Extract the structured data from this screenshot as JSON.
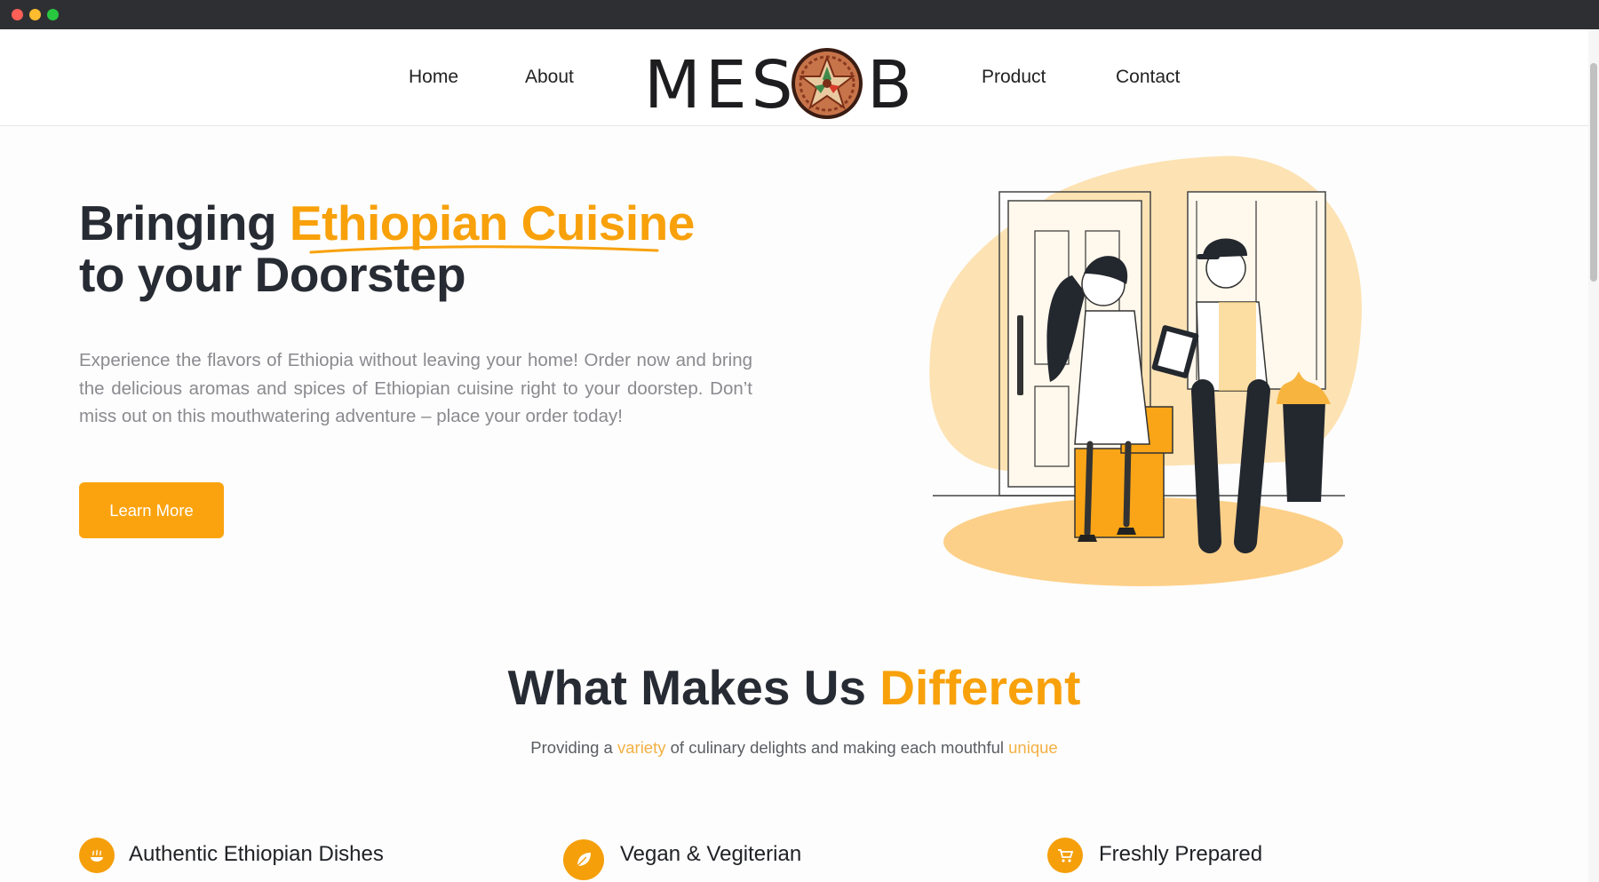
{
  "nav": {
    "left_links": [
      "Home",
      "About"
    ],
    "right_links": [
      "Product",
      "Contact"
    ],
    "logo": {
      "text_before": "MES",
      "text_after": "B",
      "icon": "mesob-basket-icon"
    }
  },
  "hero": {
    "title_part1": "Bringing ",
    "title_accent": "Ethiopian Cuisine",
    "title_line2": "to your Doorstep",
    "description": "Experience the flavors of Ethiopia without leaving your home! Order now and bring the delicious aromas and spices of Ethiopian cuisine right to your doorstep. Don’t miss out on this mouthwatering adventure – place your order today!",
    "button_label": "Learn More",
    "illustration": "delivery-illustration"
  },
  "section": {
    "title_plain": "What Makes Us ",
    "title_accent": "Different",
    "sub_1": "Providing a ",
    "sub_hl_1": "variety",
    "sub_2": " of culinary delights and making each mouthful ",
    "sub_hl_2": "unique"
  },
  "features": [
    {
      "label": "Authentic Ethiopian Dishes",
      "icon": "dish-icon"
    },
    {
      "label": "Vegan & Vegiterian",
      "icon": "leaf-icon"
    },
    {
      "label": "Freshly Prepared",
      "icon": "cart-icon"
    }
  ],
  "colors": {
    "accent": "#f8a10b",
    "button": "#fba30e",
    "text": "#272b33",
    "muted": "#8a8a8f"
  }
}
